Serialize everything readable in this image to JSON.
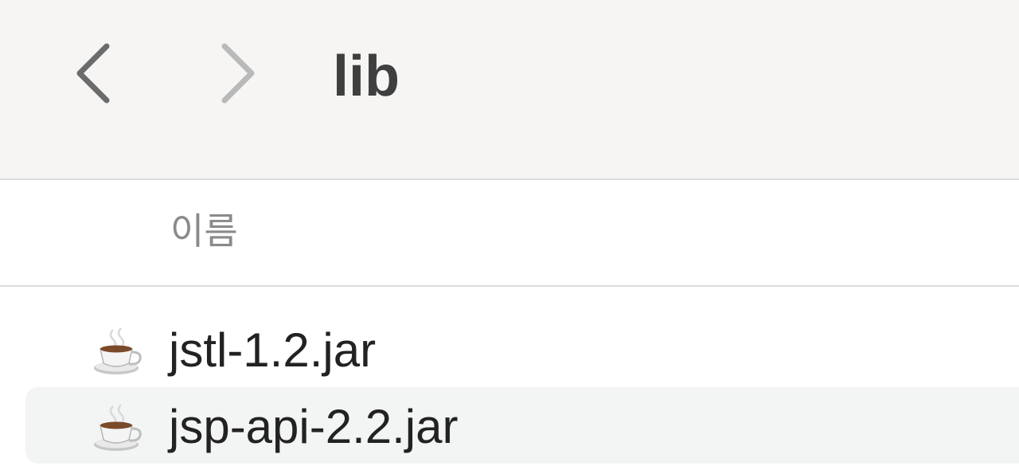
{
  "toolbar": {
    "title": "lib",
    "back_icon": "chevron-left-icon",
    "forward_icon": "chevron-right-icon"
  },
  "columns": {
    "name_label": "이름"
  },
  "files": [
    {
      "name": "jstl-1.2.jar",
      "icon": "java-coffee-cup-icon"
    },
    {
      "name": "jsp-api-2.2.jar",
      "icon": "java-coffee-cup-icon"
    }
  ],
  "colors": {
    "toolbar_bg": "#f6f5f4",
    "title": "#3f3f3f",
    "header_text": "#8a8a8a",
    "row_alt_bg": "#f3f4f4",
    "nav_enabled": "#6b6b6b",
    "nav_disabled": "#b9b9b9"
  }
}
